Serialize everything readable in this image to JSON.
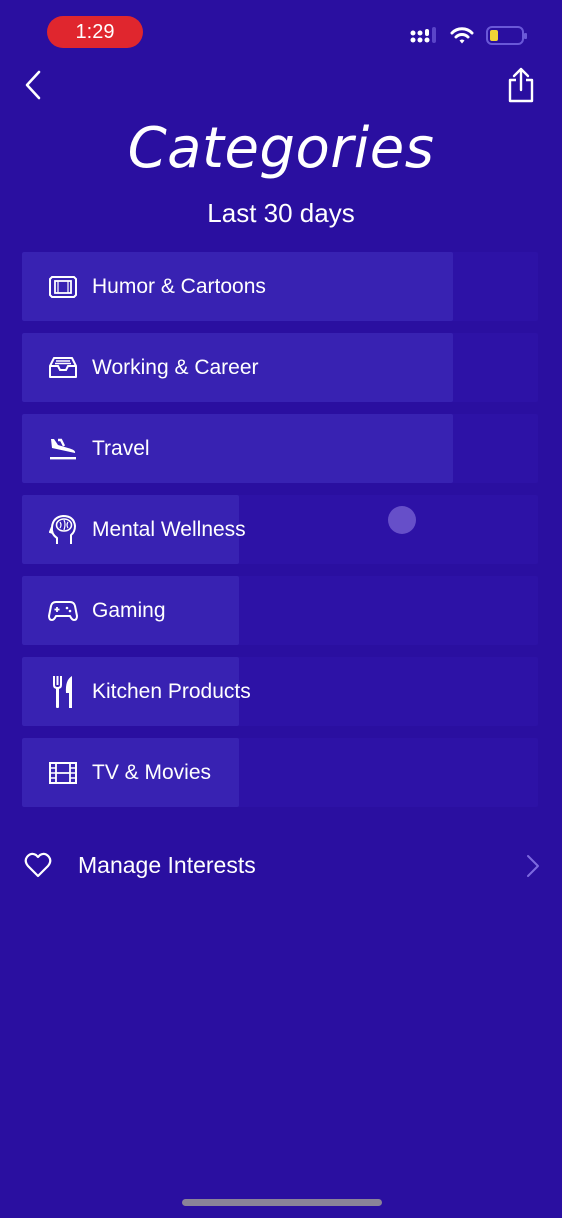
{
  "status_bar": {
    "time": "1:29",
    "icons": [
      "signal-icon",
      "wifi-icon",
      "battery-icon"
    ],
    "battery_level": 0.2,
    "colors": {
      "time_pill": "#e0262e",
      "battery_fill": "#f1d437"
    }
  },
  "nav": {
    "back_icon": "chevron-left-icon",
    "share_icon": "share-icon"
  },
  "header": {
    "title": "Categories",
    "subtitle": "Last 30 days"
  },
  "categories": [
    {
      "label": "Humor & Cartoons",
      "icon": "tv-screen-icon",
      "share": 0.835
    },
    {
      "label": "Working & Career",
      "icon": "inbox-tray-icon",
      "share": 0.835
    },
    {
      "label": "Travel",
      "icon": "airplane-landing-icon",
      "share": 0.835
    },
    {
      "label": "Mental Wellness",
      "icon": "brain-head-icon",
      "share": 0.42
    },
    {
      "label": "Gaming",
      "icon": "gamepad-icon",
      "share": 0.42
    },
    {
      "label": "Kitchen Products",
      "icon": "fork-knife-icon",
      "share": 0.42
    },
    {
      "label": "TV & Movies",
      "icon": "film-icon",
      "share": 0.42
    }
  ],
  "manage": {
    "label": "Manage Interests",
    "icon": "heart-icon",
    "chevron_icon": "chevron-right-icon"
  },
  "colors": {
    "background": "#2a0fa0",
    "track": "#2d12a6",
    "bar": "#3822b2",
    "chevron": "#7d6ae0"
  }
}
